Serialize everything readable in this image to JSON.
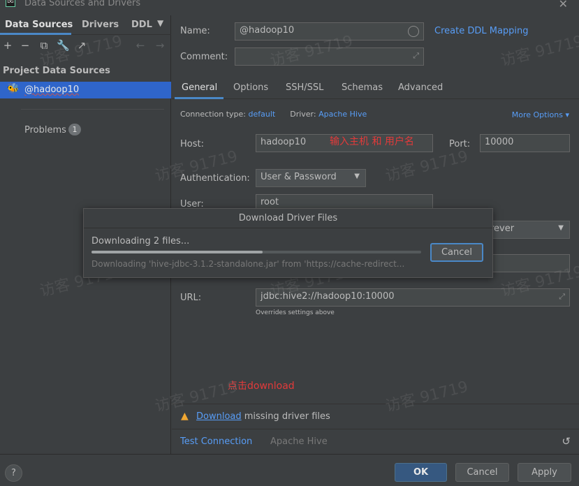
{
  "window": {
    "title": "Data Sources and Drivers",
    "close_icon": "close-icon"
  },
  "left": {
    "tabs": [
      "Data Sources",
      "Drivers",
      "DDL"
    ],
    "section_title": "Project Data Sources",
    "selected_item": "@hadoop10",
    "problems_label": "Problems",
    "problems_count": "1"
  },
  "form": {
    "name_label": "Name:",
    "name_value": "@hadoop10",
    "ddl_link": "Create DDL Mapping",
    "comment_label": "Comment:",
    "tabs": [
      "General",
      "Options",
      "SSH/SSL",
      "Schemas",
      "Advanced"
    ],
    "conn_type_label": "Connection type:",
    "conn_type_value": "default",
    "driver_label": "Driver:",
    "driver_value": "Apache Hive",
    "more_options": "More Options",
    "host_label": "Host:",
    "host_value": "hadoop10",
    "port_label": "Port:",
    "port_value": "10000",
    "auth_label": "Authentication:",
    "auth_value": "User & Password",
    "user_label": "User:",
    "user_value": "root",
    "save_value": "orever",
    "url_label": "URL:",
    "url_value": "jdbc:hive2://hadoop10:10000",
    "overrides_note": "Overrides settings above"
  },
  "annotations": {
    "host_note": "输入主机  和  用户名",
    "download_note": "点击download"
  },
  "warning": {
    "link": "Download",
    "text": " missing driver files"
  },
  "bottom": {
    "test_connection": "Test Connection",
    "driver_name": "Apache Hive"
  },
  "footer": {
    "help": "?",
    "ok": "OK",
    "cancel": "Cancel",
    "apply": "Apply"
  },
  "download_dialog": {
    "title": "Download Driver Files",
    "status": "Downloading 2 files...",
    "detail": "Downloading 'hive-jdbc-3.1.2-standalone.jar' from 'https://cache-redirect...",
    "cancel": "Cancel",
    "progress_percent": 52
  },
  "watermark": "访客 91719",
  "colors": {
    "accent": "#4a88c7",
    "link": "#589df6",
    "selection": "#2f65ca",
    "warning": "#f0a732",
    "annotation": "#e23a3a"
  }
}
